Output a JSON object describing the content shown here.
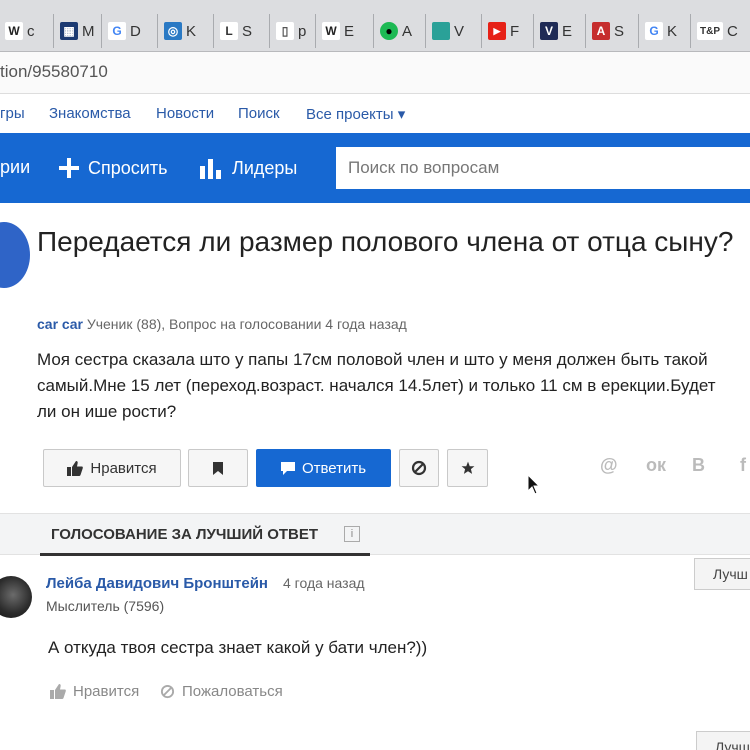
{
  "browser": {
    "tabs": [
      {
        "letter": "W",
        "title": "c",
        "color": "#ffffff",
        "text": "#222"
      },
      {
        "letter": "▦",
        "title": "M",
        "color": "#1c3a72",
        "text": "#fff"
      },
      {
        "letter": "G",
        "title": "D",
        "color": "#ffffff",
        "text": "#4285f4"
      },
      {
        "letter": "◎",
        "title": "K",
        "color": "#2a79c4",
        "text": "#fff"
      },
      {
        "letter": "L",
        "title": "S",
        "color": "#ffffff",
        "text": "#333"
      },
      {
        "letter": "▯",
        "title": "p",
        "color": "#ffffff",
        "text": "#555"
      },
      {
        "letter": "W",
        "title": "E",
        "color": "#ffffff",
        "text": "#222"
      },
      {
        "letter": "●",
        "title": "A",
        "color": "#1db954",
        "text": "#000"
      },
      {
        "letter": "",
        "title": "V",
        "color": "#2aa198",
        "text": "#fff"
      },
      {
        "letter": "▶",
        "title": "F",
        "color": "#e62117",
        "text": "#fff"
      },
      {
        "letter": "V",
        "title": "E",
        "color": "#1f2b56",
        "text": "#fff"
      },
      {
        "letter": "A",
        "title": "S",
        "color": "#c62d2d",
        "text": "#fff"
      },
      {
        "letter": "G",
        "title": "K",
        "color": "#ffffff",
        "text": "#4285f4"
      },
      {
        "letter": "T&P",
        "title": "C",
        "color": "#ffffff",
        "text": "#333"
      }
    ],
    "url": "tion/95580710"
  },
  "project_nav": {
    "items": [
      "гры",
      "Знакомства",
      "Новости",
      "Поиск",
      "Все проекты ▾"
    ]
  },
  "header": {
    "categories_label": "рии",
    "ask_label": "Спросить",
    "leaders_label": "Лидеры",
    "search_placeholder": "Поиск по вопросам"
  },
  "question": {
    "title": "Передается ли размер полового члена от отца сыну?",
    "author": "car car",
    "meta": "Ученик (88), Вопрос на голосовании 4 года назад",
    "body": "Моя сестра сказала што у папы 17см половой член и што у меня должен быть такой самый.Мне 15 лет (переход.возраст. начался 14.5лет) и только 11 см в ерекции.Будет ли он ише рости?",
    "like_label": "Нравится",
    "answer_label": "Ответить",
    "share": [
      "@",
      "ок",
      "В",
      "f"
    ]
  },
  "voting": {
    "title": "ГОЛОСОВАНИЕ ЗА ЛУЧШИЙ ОТВЕТ",
    "info": "i"
  },
  "answer": {
    "name": "Лейба Давидович Бронштейн",
    "time": "4 года назад",
    "rank": "Мыслитель (7596)",
    "text": "А откуда твоя сестра знает какой у бати член?))",
    "like_label": "Нравится",
    "report_label": "Пожаловаться",
    "best_label": "Лучш",
    "best_label_2": "Лучш"
  }
}
